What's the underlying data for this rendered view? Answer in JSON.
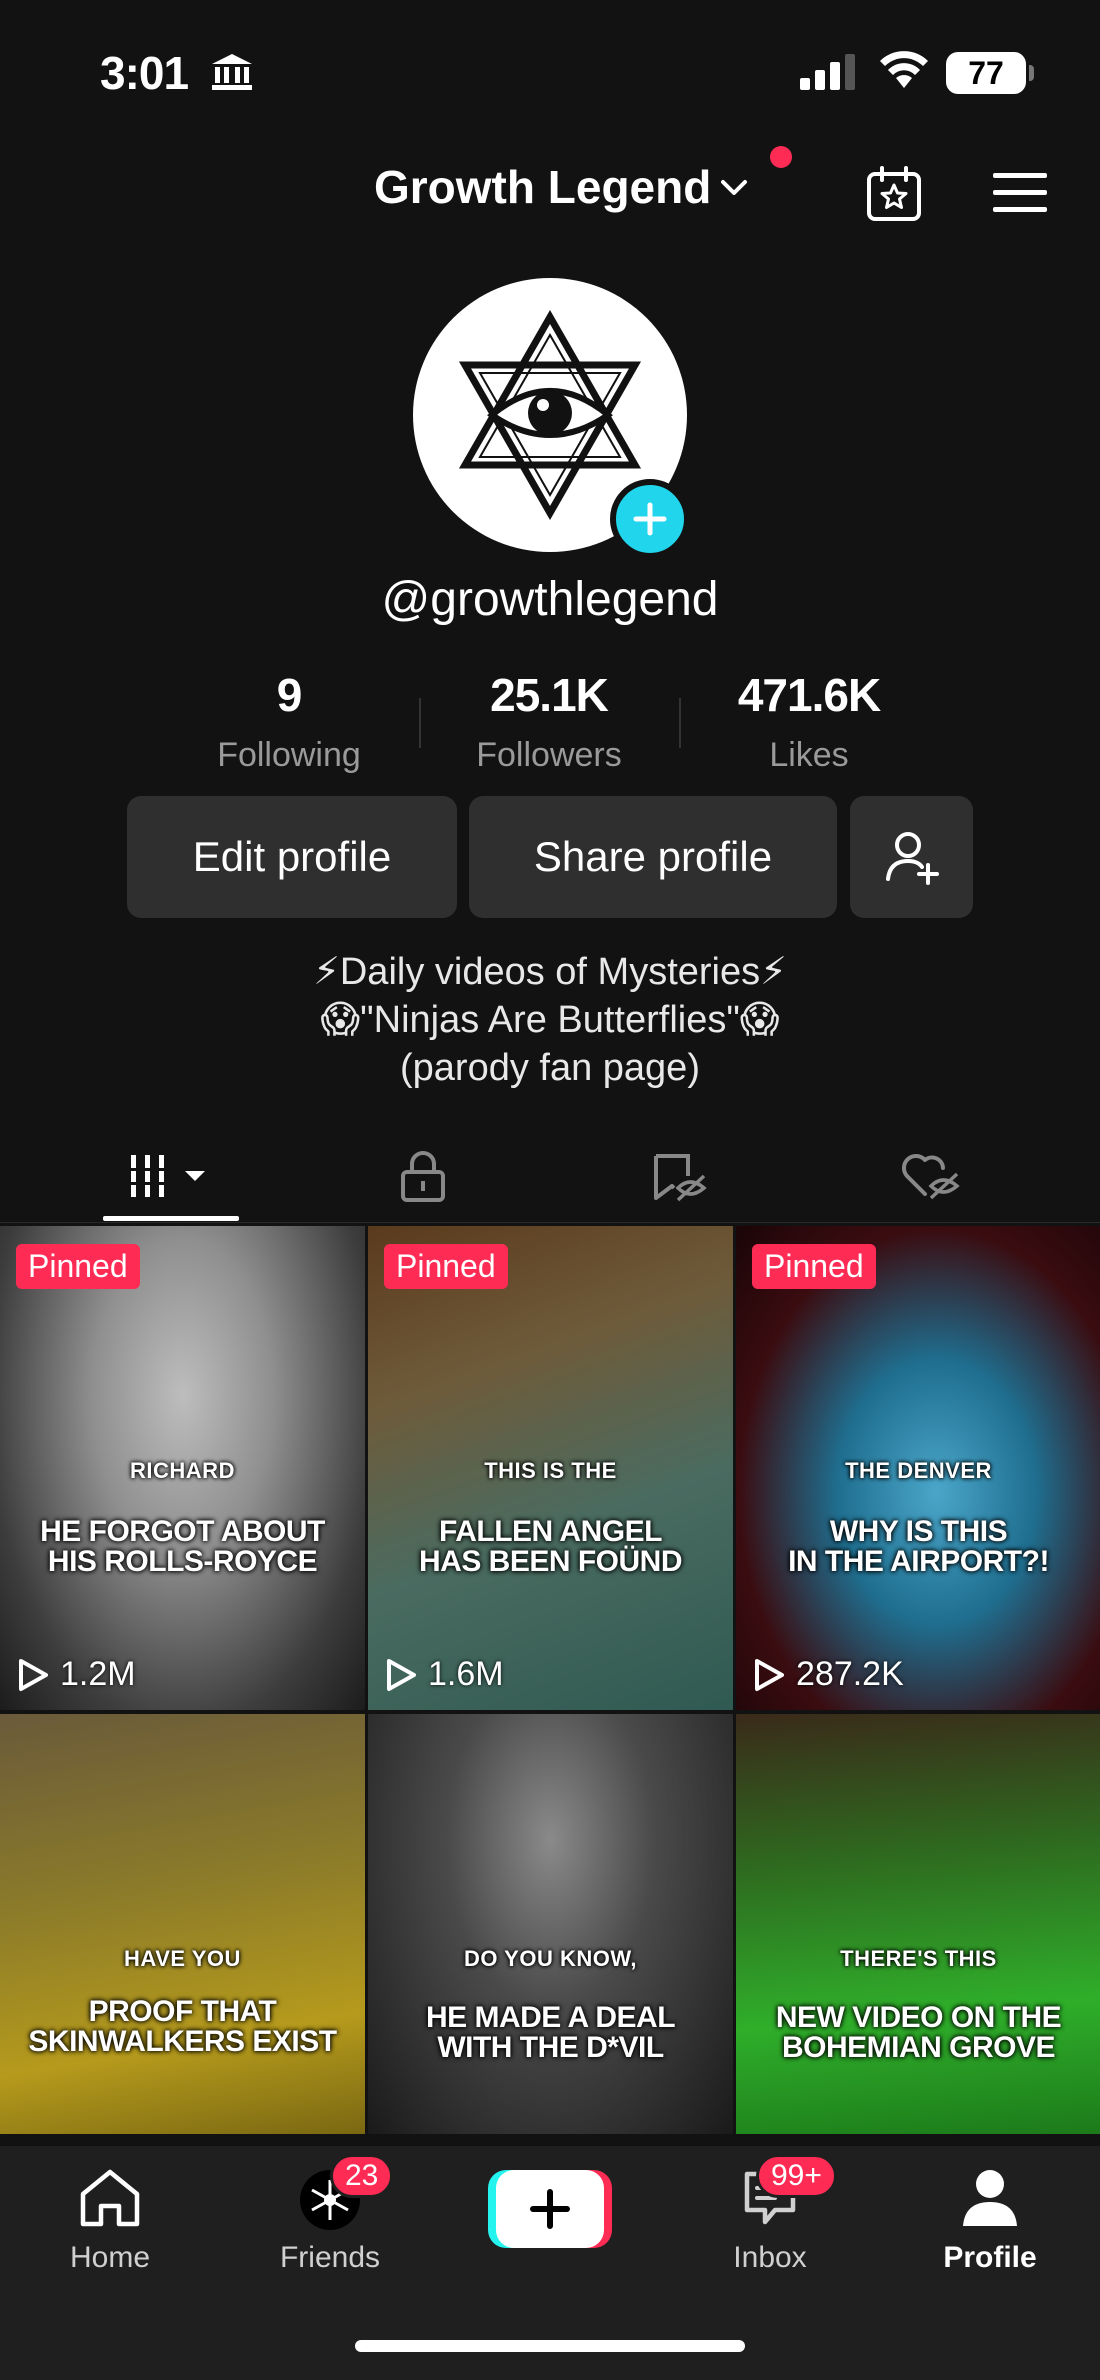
{
  "status_bar": {
    "time": "3:01",
    "battery": "77"
  },
  "header": {
    "title": "Growth Legend"
  },
  "profile": {
    "handle": "@growthlegend",
    "stats": [
      {
        "value": "9",
        "label": "Following"
      },
      {
        "value": "25.1K",
        "label": "Followers"
      },
      {
        "value": "471.6K",
        "label": "Likes"
      }
    ],
    "edit_label": "Edit profile",
    "share_label": "Share profile",
    "bio": [
      "⚡Daily videos of Mysteries⚡",
      "😱\"Ninjas Are Butterflies\"😱",
      "(parody fan page)"
    ]
  },
  "videos": [
    {
      "pinned": "Pinned",
      "small": "RICHARD",
      "line1": "HE FORGOT ABOUT",
      "line2": "HIS ROLLS-ROYCE",
      "views": "1.2M"
    },
    {
      "pinned": "Pinned",
      "small": "THIS IS THE",
      "line1": "FALLEN ANGEL",
      "line2": "HAS BEEN FOÜND",
      "views": "1.6M"
    },
    {
      "pinned": "Pinned",
      "small": "THE DENVER",
      "line1": "WHY IS THIS",
      "line2": "IN THE AIRPORT?!",
      "views": "287.2K"
    },
    {
      "small": "HAVE YOU",
      "line1": "PROOF THAT",
      "line2": "SKINWALKERS EXIST"
    },
    {
      "small": "DO YOU KNOW,",
      "line1": "HE MADE A DEAL",
      "line2": "WITH THE D*VIL"
    },
    {
      "small": "THERE'S THIS",
      "line1": "NEW VIDEO ON THE",
      "line2": "BOHEMIAN GROVE"
    }
  ],
  "nav": {
    "home": "Home",
    "friends": "Friends",
    "friends_badge": "23",
    "inbox": "Inbox",
    "inbox_badge": "99+",
    "profile": "Profile"
  },
  "colors": {
    "accent_red": "#fe2c55",
    "accent_cyan": "#20d5ec",
    "caption_cyan": "#3ee6f2",
    "background": "#121212"
  }
}
